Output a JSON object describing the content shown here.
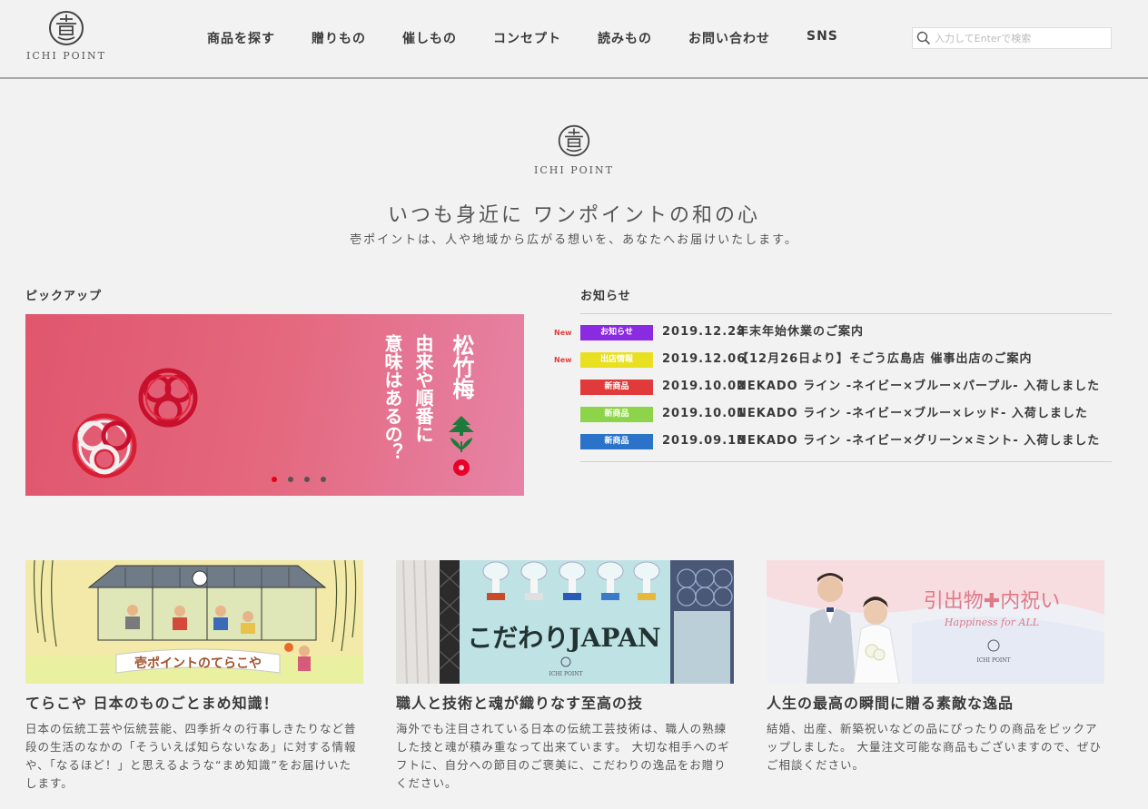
{
  "header": {
    "logo_text": "ICHI POINT",
    "nav": [
      "商品を探す",
      "贈りもの",
      "催しもの",
      "コンセプト",
      "読みもの",
      "お問い合わせ",
      "SNS"
    ],
    "search_placeholder": "入力してEnterで検索"
  },
  "hero": {
    "logo_text": "ICHI POINT",
    "tagline": "いつも身近に ワンポイントの和の心",
    "subtitle": "壱ポイントは、人や地域から広がる想いを、あなたへお届けいたします。"
  },
  "pickup": {
    "title": "ピックアップ",
    "banner_heading": "松竹梅",
    "banner_lines": [
      "由来や順番に",
      "意味はあるの？"
    ],
    "slide_count": 4,
    "active_slide": 1
  },
  "news": {
    "title": "お知らせ",
    "items": [
      {
        "new": "New",
        "category": "お知らせ",
        "cat_color": "#8a2be2",
        "date": "2019.12.23",
        "title": "年末年始休業のご案内"
      },
      {
        "new": "New",
        "category": "出店情報",
        "cat_color": "#e8e020",
        "date": "2019.12.06",
        "title": "【12月26日より】そごう広島店 催事出店のご案内"
      },
      {
        "new": "",
        "category": "新商品",
        "cat_color": "#e03a3a",
        "date": "2019.10.02",
        "title": "NEKADO ライン -ネイビー×ブルー×パープル- 入荷しました"
      },
      {
        "new": "",
        "category": "新商品",
        "cat_color": "#8ed44a",
        "date": "2019.10.01",
        "title": "NEKADO ライン -ネイビー×ブルー×レッド- 入荷しました"
      },
      {
        "new": "",
        "category": "新商品",
        "cat_color": "#2a73c8",
        "date": "2019.09.18",
        "title": "NEKADO ライン -ネイビー×グリーン×ミント- 入荷しました"
      }
    ]
  },
  "cards": [
    {
      "image_text": "壱ポイントのてらこや",
      "title": "てらこや 日本のものごとまめ知識！",
      "desc": "日本の伝統工芸や伝統芸能、四季折々の行事しきたりなど普段の生活のなかの「そういえば知らないなあ」に対する情報や、「なるほど！」と思えるような“まめ知識”をお届けいたします。"
    },
    {
      "image_text": "こだわりJAPAN",
      "image_logo": "ICHI POINT",
      "title": "職人と技術と魂が織りなす至高の技",
      "desc": "海外でも注目されている日本の伝統工芸技術は、職人の熟練した技と魂が積み重なって出来ています。 大切な相手へのギフトに、自分への節目のご褒美に、こだわりの逸品をお贈りください。"
    },
    {
      "image_text": "引出物✚内祝い",
      "image_sub": "Happiness for ALL",
      "image_logo": "ICHI POINT",
      "title": "人生の最高の瞬間に贈る素敵な逸品",
      "desc": "結婚、出産、新築祝いなどの品にぴったりの商品をピックアップしました。 大量注文可能な商品もございますので、ぜひご相談ください。"
    }
  ]
}
